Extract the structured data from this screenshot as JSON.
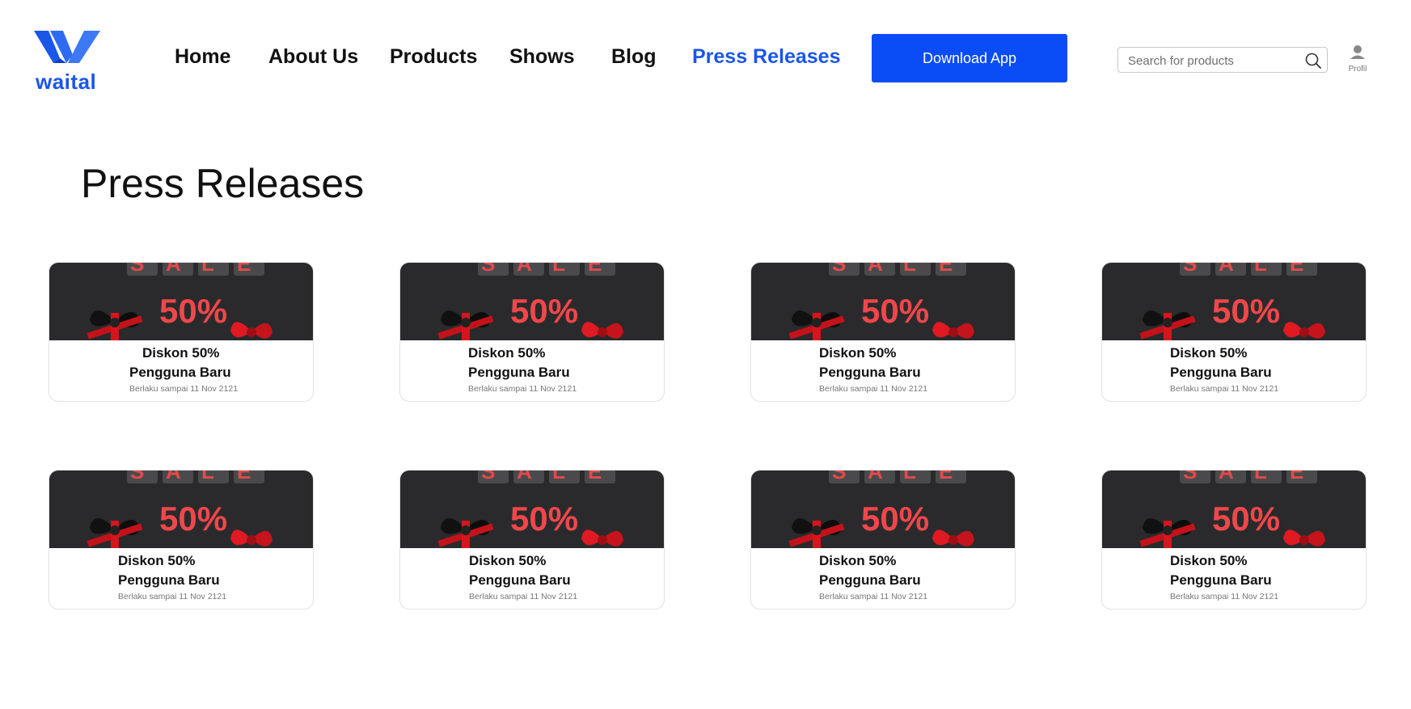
{
  "brand": {
    "name": "waital",
    "color": "#1a56e8"
  },
  "nav": {
    "items": [
      {
        "label": "Home",
        "active": false
      },
      {
        "label": "About Us",
        "active": false
      },
      {
        "label": "Products",
        "active": false
      },
      {
        "label": "Shows",
        "active": false
      },
      {
        "label": "Blog",
        "active": false
      },
      {
        "label": "Press Releases",
        "active": true
      }
    ],
    "download_label": "Download App"
  },
  "search": {
    "placeholder": "Search for products",
    "value": ""
  },
  "profile": {
    "label": "Profil"
  },
  "page": {
    "title": "Press Releases"
  },
  "cards": [
    {
      "image_text": "SALE",
      "discount_text": "50%",
      "title_line1": "Diskon 50%",
      "title_line2": "Pengguna Baru",
      "subtitle": "Berlaku sampai 11 Nov 2121"
    },
    {
      "image_text": "SALE",
      "discount_text": "50%",
      "title_line1": "Diskon 50%",
      "title_line2": "Pengguna Baru",
      "subtitle": "Berlaku sampai 11 Nov 2121"
    },
    {
      "image_text": "SALE",
      "discount_text": "50%",
      "title_line1": "Diskon 50%",
      "title_line2": "Pengguna Baru",
      "subtitle": "Berlaku sampai 11 Nov 2121"
    },
    {
      "image_text": "SALE",
      "discount_text": "50%",
      "title_line1": "Diskon 50%",
      "title_line2": "Pengguna Baru",
      "subtitle": "Berlaku sampai 11 Nov 2121"
    },
    {
      "image_text": "SALE",
      "discount_text": "50%",
      "title_line1": "Diskon 50%",
      "title_line2": "Pengguna Baru",
      "subtitle": "Berlaku sampai 11 Nov 2121"
    },
    {
      "image_text": "SALE",
      "discount_text": "50%",
      "title_line1": "Diskon 50%",
      "title_line2": "Pengguna Baru",
      "subtitle": "Berlaku sampai 11 Nov 2121"
    },
    {
      "image_text": "SALE",
      "discount_text": "50%",
      "title_line1": "Diskon 50%",
      "title_line2": "Pengguna Baru",
      "subtitle": "Berlaku sampai 11 Nov 2121"
    },
    {
      "image_text": "SALE",
      "discount_text": "50%",
      "title_line1": "Diskon 50%",
      "title_line2": "Pengguna Baru",
      "subtitle": "Berlaku sampai 11 Nov 2121"
    }
  ],
  "colors": {
    "accent": "#1a56e8",
    "button": "#0a4cf5",
    "sale_red": "#f0474a",
    "image_bg": "#2a2a2d"
  }
}
